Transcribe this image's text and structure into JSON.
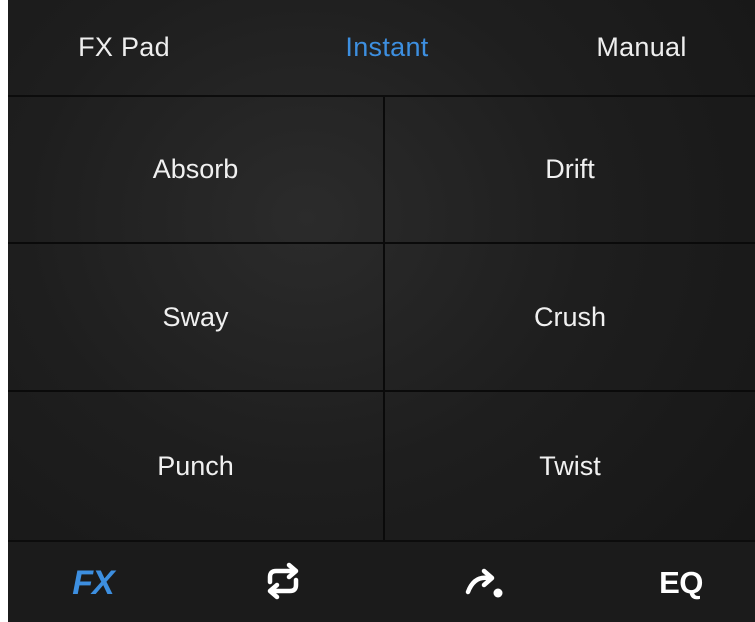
{
  "tabs": [
    {
      "label": "FX Pad",
      "active": false
    },
    {
      "label": "Instant",
      "active": true
    },
    {
      "label": "Manual",
      "active": false
    }
  ],
  "pads": [
    {
      "label": "Absorb"
    },
    {
      "label": "Drift"
    },
    {
      "label": "Sway"
    },
    {
      "label": "Crush"
    },
    {
      "label": "Punch"
    },
    {
      "label": "Twist"
    }
  ],
  "toolbar": {
    "fx_label": "FX",
    "loop_icon": "loop-icon",
    "roll_icon": "roll-icon",
    "eq_label": "EQ"
  },
  "colors": {
    "accent": "#3d8fe0",
    "background": "#1e1e1e",
    "text": "#f0f0f0",
    "divider": "#0a0a0a"
  }
}
